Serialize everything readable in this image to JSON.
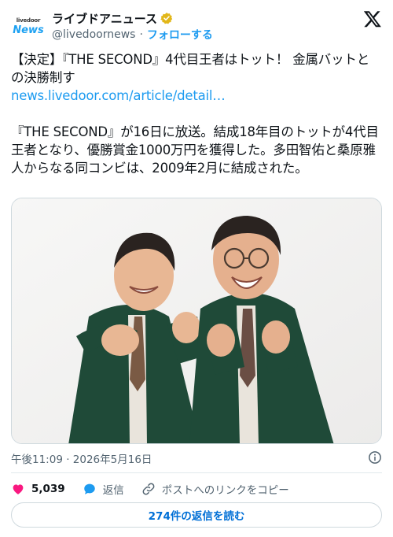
{
  "account": {
    "avatar_line1": "livedoor",
    "avatar_line2": "News",
    "display_name": "ライブドアニュース",
    "handle": "@livedoornews",
    "separator": "·",
    "follow_label": "フォローする"
  },
  "tweet": {
    "headline": "【決定】『THE SECOND』4代目王者はトット！ 金属バットとの決勝制す",
    "link_text": "news.livedoor.com/article/detail…",
    "body": "『THE SECOND』が16日に放送。結成18年目のトットが4代目王者となり、優勝賞金1000万円を獲得した。多田智佑と桑原雅人からなる同コンビは、2009年2月に結成された。"
  },
  "meta": {
    "timestamp": "午後11:09 · 2026年5月16日"
  },
  "actions": {
    "like_count": "5,039",
    "reply_label": "返信",
    "copy_link_label": "ポストへのリンクをコピー"
  },
  "footer": {
    "read_replies_label": "274件の返信を読む"
  },
  "colors": {
    "accent": "#1d9bf0",
    "like": "#f91880",
    "suit": "#1f4a38",
    "muted": "#536471"
  }
}
